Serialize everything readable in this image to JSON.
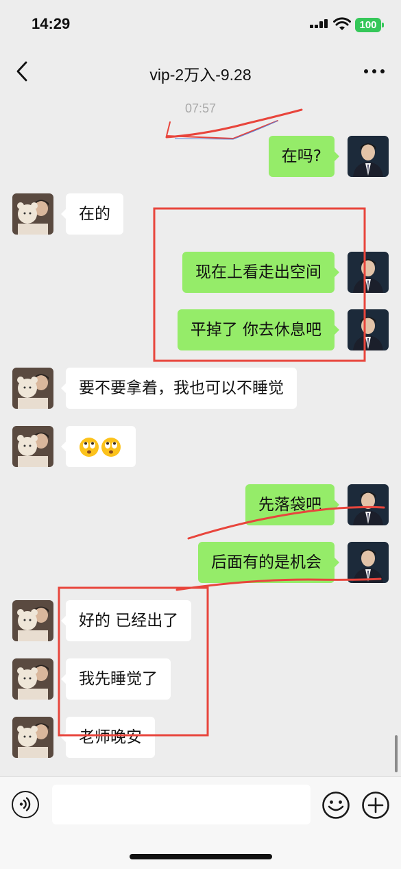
{
  "status_bar": {
    "time": "14:29",
    "battery": "100",
    "battery_color": "#35c759"
  },
  "nav": {
    "title": "vip-2万入-9.28",
    "back_icon": "chevron-left-icon",
    "more_icon": "ellipsis-icon"
  },
  "chat": {
    "timestamp": "07:57",
    "messages": [
      {
        "direction": "out",
        "text": "在吗?"
      },
      {
        "direction": "in",
        "text": "在的"
      },
      {
        "direction": "out",
        "text": "现在上看走出空间"
      },
      {
        "direction": "out",
        "text": "平掉了 你去休息吧"
      },
      {
        "direction": "in",
        "text": "要不要拿着，我也可以不睡觉"
      },
      {
        "direction": "in",
        "text": "",
        "emoji": [
          "rolling-eyes-emoji",
          "rolling-eyes-emoji"
        ]
      },
      {
        "direction": "out",
        "text": "先落袋吧"
      },
      {
        "direction": "out",
        "text": "后面有的是机会"
      },
      {
        "direction": "in",
        "text": "好的 已经出了"
      },
      {
        "direction": "in",
        "text": "我先睡觉了"
      },
      {
        "direction": "in",
        "text": "老师晚安"
      }
    ]
  },
  "input_bar": {
    "voice_icon": "voice-icon",
    "emoji_icon": "smiley-icon",
    "plus_icon": "plus-icon",
    "value": ""
  },
  "colors": {
    "background": "#ededed",
    "outgoing_bubble": "#95ec69",
    "incoming_bubble": "#ffffff",
    "annotation": "#e8453c"
  }
}
